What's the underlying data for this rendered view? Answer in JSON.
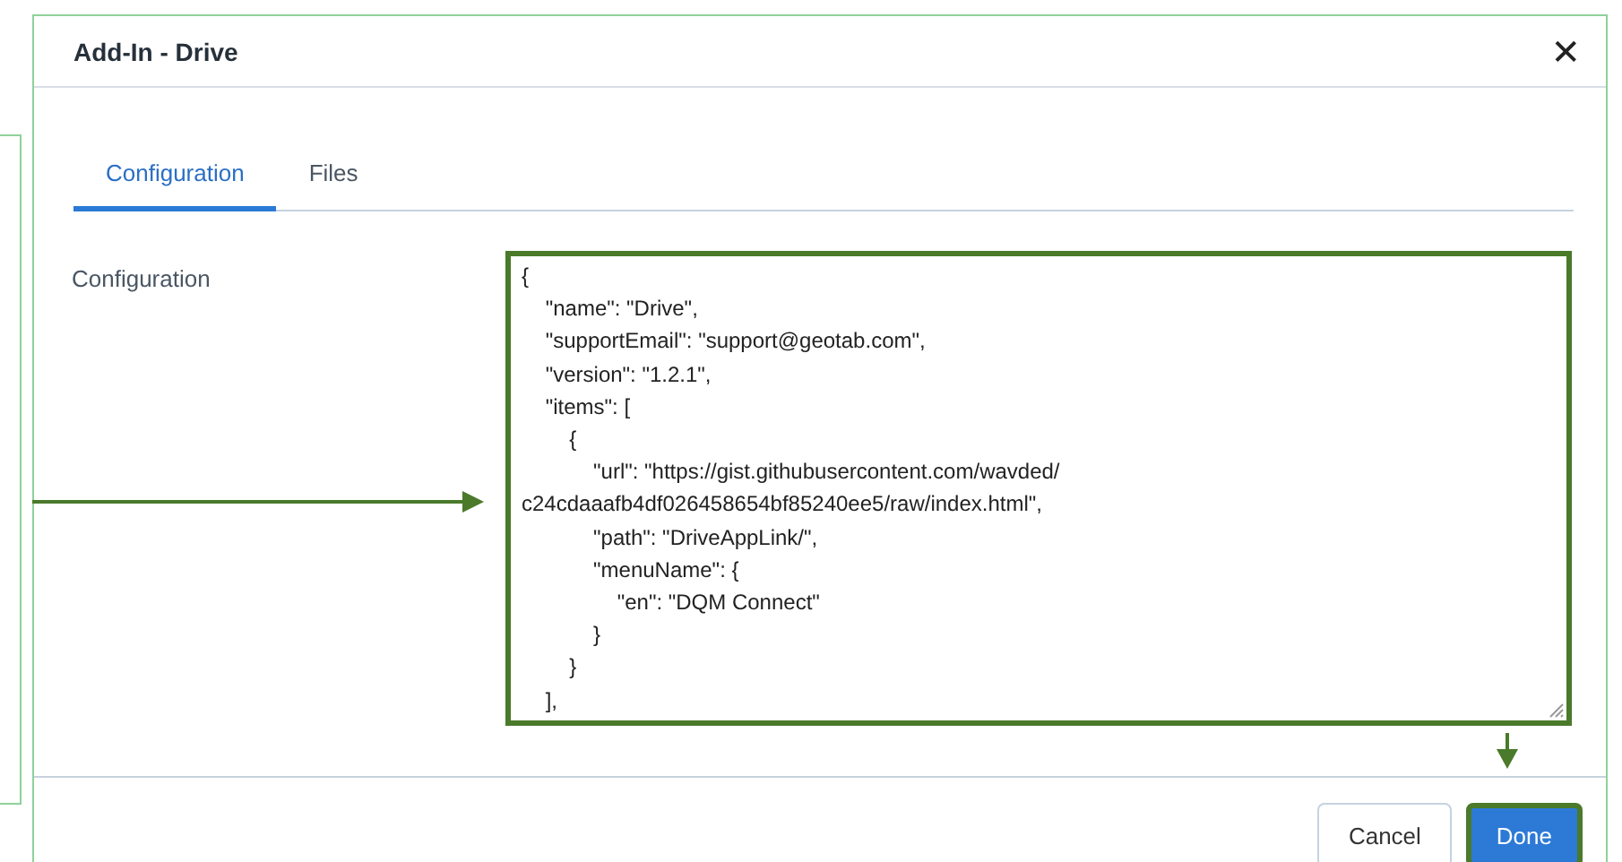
{
  "dialog": {
    "title": "Add-In - Drive",
    "close_icon": "✕"
  },
  "tabs": [
    {
      "label": "Configuration",
      "selected": true
    },
    {
      "label": "Files",
      "selected": false
    }
  ],
  "field": {
    "label": "Configuration",
    "value": "{\n    \"name\": \"Drive\",\n    \"supportEmail\": \"support@geotab.com\",\n    \"version\": \"1.2.1\",\n    \"items\": [\n        {\n            \"url\": \"https://gist.githubusercontent.com/wavded/ c24cdaaafb4df026458654bf85240ee5/raw/index.html\",\n            \"path\": \"DriveAppLink/\",\n            \"menuName\": {\n                \"en\": \"DQM Connect\"\n            }\n        }\n    ],"
  },
  "buttons": [
    {
      "label": "Cancel",
      "kind": "secondary"
    },
    {
      "label": "Done",
      "kind": "primary"
    }
  ]
}
